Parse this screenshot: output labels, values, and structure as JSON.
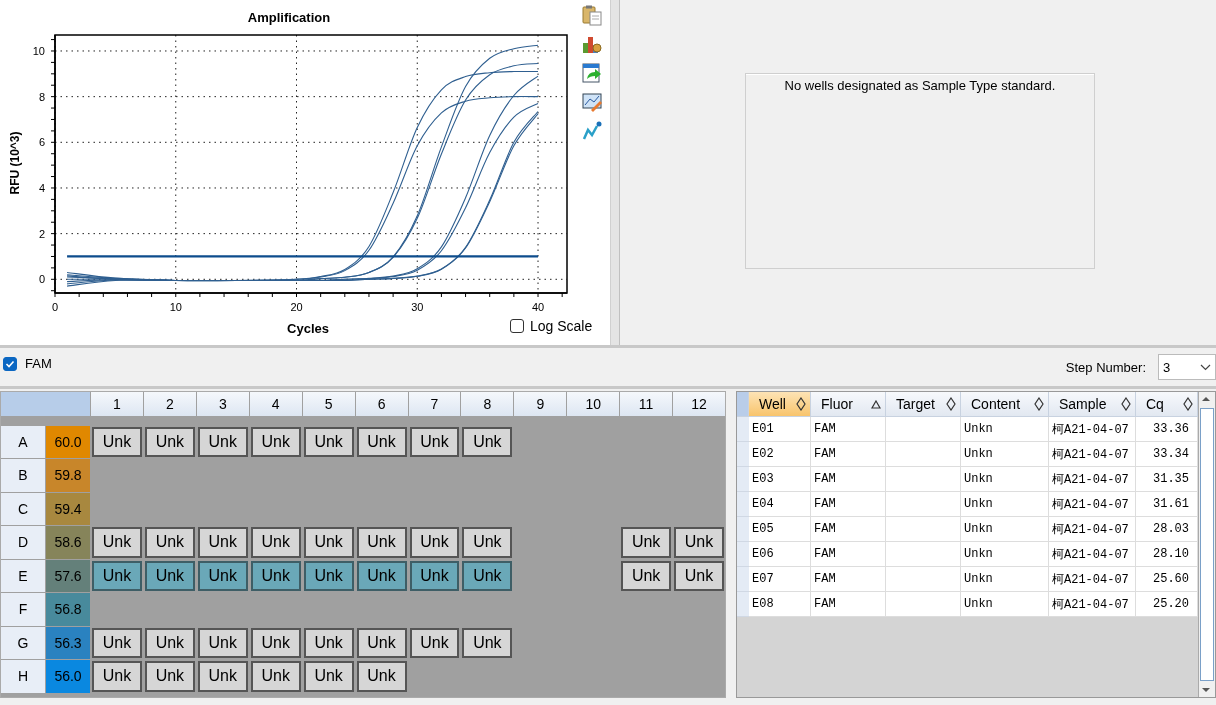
{
  "amplification": {
    "chart_data": {
      "type": "line",
      "title": "Amplification",
      "xlabel": "Cycles",
      "ylabel": "RFU (10^3)",
      "x": [
        1,
        5,
        10,
        15,
        20,
        22,
        24,
        26,
        28,
        30,
        32,
        34,
        36,
        38,
        40
      ],
      "xlim": [
        0,
        42.4
      ],
      "ylim": [
        -0.6,
        10.7
      ],
      "grid": true,
      "xticks": [
        0,
        10,
        20,
        30,
        40
      ],
      "yticks": [
        0,
        2,
        4,
        6,
        8,
        10
      ],
      "series": [
        {
          "color": "#2f5f90",
          "values": [
            0.3,
            0.05,
            -0.05,
            -0.05,
            0,
            0.12,
            0.43,
            1.44,
            3.8,
            6.65,
            8.3,
            8.88,
            9.05,
            9.1,
            9.1
          ]
        },
        {
          "color": "#2f5f90",
          "values": [
            0.2,
            0.04,
            -0.05,
            -0.05,
            0,
            0.1,
            0.38,
            1.27,
            3.33,
            5.85,
            7.29,
            7.8,
            7.95,
            8.0,
            8.0
          ]
        },
        {
          "color": "#2f5f90",
          "values": [
            0.1,
            0.02,
            -0.05,
            -0.05,
            -0.05,
            0.03,
            0.09,
            0.3,
            0.98,
            2.78,
            5.8,
            8.44,
            9.68,
            10.1,
            10.25
          ]
        },
        {
          "color": "#2f5f90",
          "values": [
            0,
            0,
            -0.05,
            -0.05,
            -0.05,
            0.03,
            0.09,
            0.3,
            0.96,
            2.67,
            5.49,
            7.85,
            8.96,
            9.35,
            9.45
          ]
        },
        {
          "color": "#2f5f90",
          "values": [
            -0.1,
            -0.02,
            -0.05,
            -0.05,
            -0.05,
            -0.05,
            0,
            0.04,
            0.14,
            0.46,
            1.42,
            3.57,
            6.3,
            8.05,
            8.9
          ]
        },
        {
          "color": "#2f5f90",
          "values": [
            -0.2,
            -0.03,
            -0.05,
            -0.05,
            -0.05,
            -0.05,
            0,
            0.03,
            0.12,
            0.4,
            1.25,
            3.13,
            5.55,
            7.1,
            7.7
          ]
        },
        {
          "color": "#2f5f90",
          "values": [
            -0.3,
            -0.05,
            -0.05,
            -0.05,
            -0.05,
            -0.05,
            -0.05,
            0,
            0.04,
            0.14,
            0.45,
            1.4,
            3.47,
            6.0,
            7.35
          ]
        },
        {
          "color": "#2f5f90",
          "values": [
            0.15,
            0,
            -0.05,
            -0.05,
            -0.05,
            -0.05,
            -0.05,
            0,
            0.04,
            0.13,
            0.44,
            1.37,
            3.4,
            5.85,
            7.25
          ]
        },
        {
          "color": "#0d4c8c",
          "values": [
            1,
            1,
            1,
            1,
            1,
            1,
            1,
            1,
            1,
            1,
            1,
            1,
            1,
            1,
            1
          ]
        }
      ]
    },
    "log_scale": {
      "label": "Log Scale",
      "checked": false
    }
  },
  "standard_curve": {
    "message": "No wells designated as Sample Type standard."
  },
  "fluor": {
    "label": "FAM",
    "checked": true
  },
  "step_number": {
    "label": "Step Number:",
    "value": "3"
  },
  "plate": {
    "columns": [
      "1",
      "2",
      "3",
      "4",
      "5",
      "6",
      "7",
      "8",
      "9",
      "10",
      "11",
      "12"
    ],
    "rows": [
      {
        "label": "A",
        "temp": "60.0",
        "color": "#e08800",
        "wells": [
          {
            "kind": "sample",
            "label": "Unk",
            "selected": false
          },
          {
            "kind": "sample",
            "label": "Unk",
            "selected": false
          },
          {
            "kind": "sample",
            "label": "Unk",
            "selected": false
          },
          {
            "kind": "sample",
            "label": "Unk",
            "selected": false
          },
          {
            "kind": "sample",
            "label": "Unk",
            "selected": false
          },
          {
            "kind": "sample",
            "label": "Unk",
            "selected": false
          },
          {
            "kind": "sample",
            "label": "Unk",
            "selected": false
          },
          {
            "kind": "sample",
            "label": "Unk",
            "selected": false
          },
          {
            "kind": "empty"
          },
          {
            "kind": "empty"
          },
          {
            "kind": "empty"
          },
          {
            "kind": "empty"
          }
        ]
      },
      {
        "label": "B",
        "temp": "59.8",
        "color": "#c8862a",
        "wells": [
          {
            "kind": "empty"
          },
          {
            "kind": "empty"
          },
          {
            "kind": "empty"
          },
          {
            "kind": "empty"
          },
          {
            "kind": "empty"
          },
          {
            "kind": "empty"
          },
          {
            "kind": "empty"
          },
          {
            "kind": "empty"
          },
          {
            "kind": "empty"
          },
          {
            "kind": "empty"
          },
          {
            "kind": "empty"
          },
          {
            "kind": "empty"
          }
        ]
      },
      {
        "label": "C",
        "temp": "59.4",
        "color": "#a8883f",
        "wells": [
          {
            "kind": "empty"
          },
          {
            "kind": "empty"
          },
          {
            "kind": "empty"
          },
          {
            "kind": "empty"
          },
          {
            "kind": "empty"
          },
          {
            "kind": "empty"
          },
          {
            "kind": "empty"
          },
          {
            "kind": "empty"
          },
          {
            "kind": "empty"
          },
          {
            "kind": "empty"
          },
          {
            "kind": "empty"
          },
          {
            "kind": "empty"
          }
        ]
      },
      {
        "label": "D",
        "temp": "58.6",
        "color": "#86845a",
        "wells": [
          {
            "kind": "sample",
            "label": "Unk",
            "selected": false
          },
          {
            "kind": "sample",
            "label": "Unk",
            "selected": false
          },
          {
            "kind": "sample",
            "label": "Unk",
            "selected": false
          },
          {
            "kind": "sample",
            "label": "Unk",
            "selected": false
          },
          {
            "kind": "sample",
            "label": "Unk",
            "selected": false
          },
          {
            "kind": "sample",
            "label": "Unk",
            "selected": false
          },
          {
            "kind": "sample",
            "label": "Unk",
            "selected": false
          },
          {
            "kind": "sample",
            "label": "Unk",
            "selected": false
          },
          {
            "kind": "empty"
          },
          {
            "kind": "empty"
          },
          {
            "kind": "sample",
            "label": "Unk",
            "selected": false
          },
          {
            "kind": "sample",
            "label": "Unk",
            "selected": false
          }
        ]
      },
      {
        "label": "E",
        "temp": "57.6",
        "color": "#64807a",
        "wells": [
          {
            "kind": "sample",
            "label": "Unk",
            "selected": true
          },
          {
            "kind": "sample",
            "label": "Unk",
            "selected": true
          },
          {
            "kind": "sample",
            "label": "Unk",
            "selected": true
          },
          {
            "kind": "sample",
            "label": "Unk",
            "selected": true
          },
          {
            "kind": "sample",
            "label": "Unk",
            "selected": true
          },
          {
            "kind": "sample",
            "label": "Unk",
            "selected": true
          },
          {
            "kind": "sample",
            "label": "Unk",
            "selected": true
          },
          {
            "kind": "sample",
            "label": "Unk",
            "selected": true
          },
          {
            "kind": "empty"
          },
          {
            "kind": "empty"
          },
          {
            "kind": "sample",
            "label": "Unk",
            "selected": false
          },
          {
            "kind": "sample",
            "label": "Unk",
            "selected": false
          }
        ]
      },
      {
        "label": "F",
        "temp": "56.8",
        "color": "#488a9c",
        "wells": [
          {
            "kind": "empty"
          },
          {
            "kind": "empty"
          },
          {
            "kind": "empty"
          },
          {
            "kind": "empty"
          },
          {
            "kind": "empty"
          },
          {
            "kind": "empty"
          },
          {
            "kind": "empty"
          },
          {
            "kind": "empty"
          },
          {
            "kind": "empty"
          },
          {
            "kind": "empty"
          },
          {
            "kind": "empty"
          },
          {
            "kind": "empty"
          }
        ]
      },
      {
        "label": "G",
        "temp": "56.3",
        "color": "#2a82c0",
        "wells": [
          {
            "kind": "sample",
            "label": "Unk",
            "selected": false
          },
          {
            "kind": "sample",
            "label": "Unk",
            "selected": false
          },
          {
            "kind": "sample",
            "label": "Unk",
            "selected": false
          },
          {
            "kind": "sample",
            "label": "Unk",
            "selected": false
          },
          {
            "kind": "sample",
            "label": "Unk",
            "selected": false
          },
          {
            "kind": "sample",
            "label": "Unk",
            "selected": false
          },
          {
            "kind": "sample",
            "label": "Unk",
            "selected": false
          },
          {
            "kind": "sample",
            "label": "Unk",
            "selected": false
          },
          {
            "kind": "empty"
          },
          {
            "kind": "empty"
          },
          {
            "kind": "empty"
          },
          {
            "kind": "empty"
          }
        ]
      },
      {
        "label": "H",
        "temp": "56.0",
        "color": "#0a88e0",
        "wells": [
          {
            "kind": "sample",
            "label": "Unk",
            "selected": false
          },
          {
            "kind": "sample",
            "label": "Unk",
            "selected": false
          },
          {
            "kind": "sample",
            "label": "Unk",
            "selected": false
          },
          {
            "kind": "sample",
            "label": "Unk",
            "selected": false
          },
          {
            "kind": "sample",
            "label": "Unk",
            "selected": false
          },
          {
            "kind": "sample",
            "label": "Unk",
            "selected": false
          },
          {
            "kind": "empty"
          },
          {
            "kind": "empty"
          },
          {
            "kind": "empty"
          },
          {
            "kind": "empty"
          },
          {
            "kind": "empty"
          },
          {
            "kind": "empty"
          }
        ]
      }
    ]
  },
  "results": {
    "columns": [
      {
        "label": "Well",
        "sorted": false,
        "selected": true
      },
      {
        "label": "Fluor",
        "sorted": true,
        "selected": false
      },
      {
        "label": "Target",
        "sorted": false,
        "selected": false
      },
      {
        "label": "Content",
        "sorted": false,
        "selected": false
      },
      {
        "label": "Sample",
        "sorted": false,
        "selected": false
      },
      {
        "label": "Cq",
        "sorted": false,
        "selected": false
      }
    ],
    "rows": [
      {
        "well": "E01",
        "fluor": "FAM",
        "content": "Unkn",
        "sample": "柯A21-04-07",
        "cq": "33.36"
      },
      {
        "well": "E02",
        "fluor": "FAM",
        "content": "Unkn",
        "sample": "柯A21-04-07",
        "cq": "33.34"
      },
      {
        "well": "E03",
        "fluor": "FAM",
        "content": "Unkn",
        "sample": "柯A21-04-07",
        "cq": "31.35"
      },
      {
        "well": "E04",
        "fluor": "FAM",
        "content": "Unkn",
        "sample": "柯A21-04-07",
        "cq": "31.61"
      },
      {
        "well": "E05",
        "fluor": "FAM",
        "content": "Unkn",
        "sample": "柯A21-04-07",
        "cq": "28.03"
      },
      {
        "well": "E06",
        "fluor": "FAM",
        "content": "Unkn",
        "sample": "柯A21-04-07",
        "cq": "28.10"
      },
      {
        "well": "E07",
        "fluor": "FAM",
        "content": "Unkn",
        "sample": "柯A21-04-07",
        "cq": "25.60"
      },
      {
        "well": "E08",
        "fluor": "FAM",
        "content": "Unkn",
        "sample": "柯A21-04-07",
        "cq": "25.20"
      }
    ]
  }
}
